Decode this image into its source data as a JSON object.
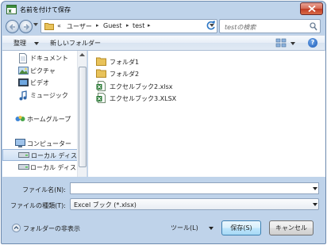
{
  "window": {
    "title": "名前を付けて保存"
  },
  "address": {
    "overflow": "«",
    "crumbs": [
      "ユーザー",
      "Guest",
      "test"
    ]
  },
  "search": {
    "placeholder": "testの検索"
  },
  "toolbar": {
    "organize": "整理",
    "new_folder": "新しいフォルダー",
    "help": "?"
  },
  "nav": {
    "items": [
      {
        "label": "ドキュメント",
        "icon": "document-icon"
      },
      {
        "label": "ピクチャ",
        "icon": "picture-icon"
      },
      {
        "label": "ビデオ",
        "icon": "video-icon"
      },
      {
        "label": "ミュージック",
        "icon": "music-icon"
      },
      {
        "label": "ホームグループ",
        "icon": "homegroup-icon"
      },
      {
        "label": "コンピューター",
        "icon": "computer-icon"
      },
      {
        "label": "ローカル ディス",
        "icon": "drive-icon"
      },
      {
        "label": "ローカル ディス",
        "icon": "drive-icon"
      }
    ]
  },
  "files": [
    {
      "name": "フォルダ1",
      "type": "folder"
    },
    {
      "name": "フォルダ2",
      "type": "folder"
    },
    {
      "name": "エクセルブック2.xlsx",
      "type": "excel"
    },
    {
      "name": "エクセルブック3.XLSX",
      "type": "excel"
    }
  ],
  "form": {
    "filename_label": "ファイル名(N):",
    "filename_value": "",
    "filetype_label": "ファイルの種類(T):",
    "filetype_value": "Excel ブック (*.xlsx)"
  },
  "footer": {
    "hide_folders": "フォルダーの非表示",
    "tools": "ツール(L)",
    "save": "保存(S)",
    "cancel": "キャンセル"
  },
  "colors": {
    "frame": "#bfd3ea",
    "accent": "#3c7fb1",
    "close": "#c13b23"
  }
}
